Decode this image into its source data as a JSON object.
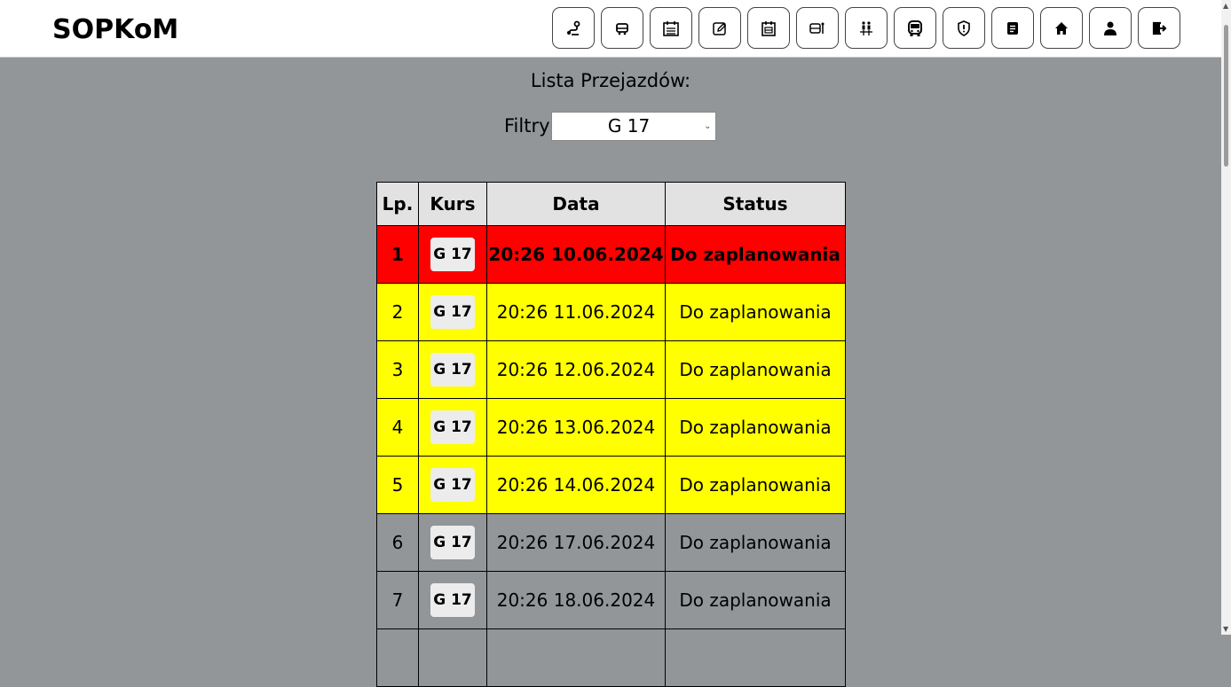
{
  "brand": "SOPKoM",
  "nav": [
    {
      "name": "route-icon"
    },
    {
      "name": "bus-stop-icon"
    },
    {
      "name": "schedule-icon"
    },
    {
      "name": "edit-icon"
    },
    {
      "name": "timetable-icon"
    },
    {
      "name": "bus-station-icon"
    },
    {
      "name": "drivers-icon"
    },
    {
      "name": "bus-icon"
    },
    {
      "name": "security-shield-icon"
    },
    {
      "name": "document-icon"
    },
    {
      "name": "home-icon"
    },
    {
      "name": "user-icon"
    },
    {
      "name": "logout-icon"
    }
  ],
  "list": {
    "title": "Lista Przejazdów:",
    "filter_label": "Filtry",
    "filter_value": "G 17"
  },
  "table": {
    "headers": [
      "Lp.",
      "Kurs",
      "Data",
      "Status"
    ],
    "rows": [
      {
        "lp": "1",
        "kurs": "G 17",
        "data": "20:26 10.06.2024",
        "status": "Do zaplanowania",
        "color": "#ff0000"
      },
      {
        "lp": "2",
        "kurs": "G 17",
        "data": "20:26 11.06.2024",
        "status": "Do zaplanowania",
        "color": "#ffff00"
      },
      {
        "lp": "3",
        "kurs": "G 17",
        "data": "20:26 12.06.2024",
        "status": "Do zaplanowania",
        "color": "#ffff00"
      },
      {
        "lp": "4",
        "kurs": "G 17",
        "data": "20:26 13.06.2024",
        "status": "Do zaplanowania",
        "color": "#ffff00"
      },
      {
        "lp": "5",
        "kurs": "G 17",
        "data": "20:26 14.06.2024",
        "status": "Do zaplanowania",
        "color": "#ffff00"
      },
      {
        "lp": "6",
        "kurs": "G 17",
        "data": "20:26 17.06.2024",
        "status": "Do zaplanowania",
        "color": "#929699"
      },
      {
        "lp": "7",
        "kurs": "G 17",
        "data": "20:26 18.06.2024",
        "status": "Do zaplanowania",
        "color": "#929699"
      }
    ]
  }
}
